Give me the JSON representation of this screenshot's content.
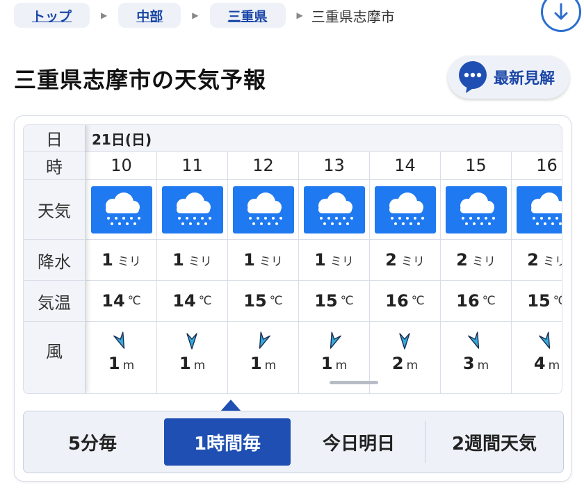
{
  "breadcrumb": {
    "items": [
      "トップ",
      "中部",
      "三重県"
    ],
    "current": "三重県志摩市"
  },
  "download_icon": "arrow-down-circle-icon",
  "title": "三重県志摩市の天気予報",
  "latest_button": {
    "label": "最新見解",
    "icon": "chat-bubble-dots-icon"
  },
  "forecast": {
    "row_labels": {
      "day": "日",
      "hour": "時",
      "weather": "天気",
      "precip": "降水",
      "temp": "気温",
      "wind": "風"
    },
    "day": "21日(日)",
    "precip_unit": "ミリ",
    "temp_unit": "℃",
    "wind_unit": "m",
    "weather_icon": "heavy-rain-icon",
    "hours": [
      {
        "hour": "10",
        "precip": "1",
        "temp": "14",
        "wind": "1",
        "wind_dir": "south-southeast"
      },
      {
        "hour": "11",
        "precip": "1",
        "temp": "14",
        "wind": "1",
        "wind_dir": "south"
      },
      {
        "hour": "12",
        "precip": "1",
        "temp": "15",
        "wind": "1",
        "wind_dir": "south-southwest"
      },
      {
        "hour": "13",
        "precip": "1",
        "temp": "15",
        "wind": "1",
        "wind_dir": "south-southwest"
      },
      {
        "hour": "14",
        "precip": "2",
        "temp": "16",
        "wind": "2",
        "wind_dir": "south"
      },
      {
        "hour": "15",
        "precip": "2",
        "temp": "16",
        "wind": "3",
        "wind_dir": "south-southeast"
      },
      {
        "hour": "16",
        "precip": "2",
        "temp": "15",
        "wind": "4",
        "wind_dir": "south-southeast"
      }
    ]
  },
  "tabs": {
    "items": [
      "5分毎",
      "1時間毎",
      "今日明日",
      "2週間天気"
    ],
    "active": "1時間毎"
  },
  "colors": {
    "accent": "#1f4fb2",
    "weather_tile": "#1f79f0",
    "link": "#1a46a8",
    "wind_arrow": "#35a9d8"
  }
}
